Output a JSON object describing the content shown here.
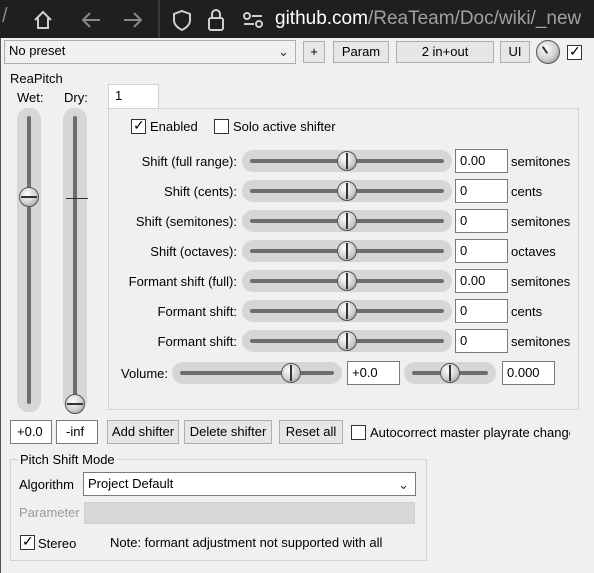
{
  "browser": {
    "url_host": "github.com",
    "url_path": "/ReaTeam/Doc/wiki/_new"
  },
  "toolbar": {
    "preset": "No preset",
    "plus_label": "+",
    "param_label": "Param",
    "io_label": "2 in+out",
    "ui_label": "UI"
  },
  "plugin_name": "ReaPitch",
  "wet_label": "Wet:",
  "dry_label": "Dry:",
  "wet_value": "+0.0",
  "dry_value": "-inf",
  "wet_level": 0.72,
  "dry_level": 0.0,
  "tab_label": "1",
  "enabled_label": "Enabled",
  "enabled_checked": true,
  "solo_label": "Solo active shifter",
  "solo_checked": false,
  "shifter_rows": [
    {
      "label": "Shift (full range):",
      "value": "0.00",
      "unit": "semitones",
      "level": 0.5
    },
    {
      "label": "Shift (cents):",
      "value": "0",
      "unit": "cents",
      "level": 0.5
    },
    {
      "label": "Shift (semitones):",
      "value": "0",
      "unit": "semitones",
      "level": 0.5
    },
    {
      "label": "Shift (octaves):",
      "value": "0",
      "unit": "octaves",
      "level": 0.5
    },
    {
      "label": "Formant shift (full):",
      "value": "0.00",
      "unit": "semitones",
      "level": 0.5
    },
    {
      "label": "Formant shift:",
      "value": "0",
      "unit": "cents",
      "level": 0.5
    },
    {
      "label": "Formant shift:",
      "value": "0",
      "unit": "semitones",
      "level": 0.5
    }
  ],
  "volume": {
    "label": "Volume:",
    "value": "+0.0",
    "level": 0.72,
    "pan_value": "0.000",
    "pan_level": 0.5
  },
  "buttons": {
    "add_shifter": "Add shifter",
    "delete_shifter": "Delete shifter",
    "reset_all": "Reset all"
  },
  "autocorrect_label": "Autocorrect master playrate change",
  "autocorrect_checked": false,
  "pitch_mode": {
    "title": "Pitch Shift Mode",
    "algorithm_label": "Algorithm",
    "algorithm_value": "Project Default",
    "parameter_label": "Parameter",
    "stereo_label": "Stereo",
    "stereo_checked": true,
    "note": "Note: formant adjustment not supported with all"
  },
  "colors": {
    "background": "#f0f0f0",
    "slider_track": "#6e6e6e",
    "browser_bg": "#1f1f1f"
  }
}
